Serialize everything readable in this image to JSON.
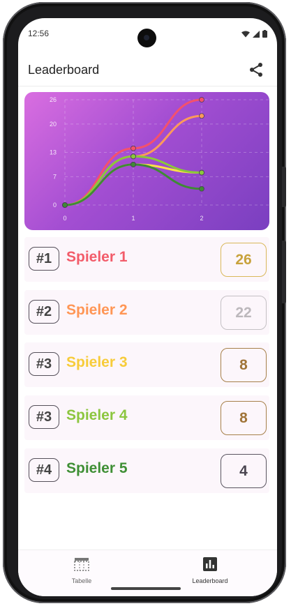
{
  "status": {
    "time": "12:56"
  },
  "appbar": {
    "title": "Leaderboard",
    "share_icon": "share-icon"
  },
  "chart_data": {
    "type": "line",
    "x": [
      0,
      1,
      2
    ],
    "x_ticks": [
      "0",
      "1",
      "2"
    ],
    "y_ticks": [
      "0",
      "7",
      "13",
      "20",
      "26"
    ],
    "ylim": [
      0,
      26
    ],
    "grid": true,
    "series": [
      {
        "color": "#f4516c",
        "values": [
          0,
          14,
          26
        ]
      },
      {
        "color": "#ff9a5a",
        "values": [
          0,
          12,
          22
        ]
      },
      {
        "color": "#fde047",
        "values": [
          0,
          10,
          8
        ]
      },
      {
        "color": "#8bc83a",
        "values": [
          0,
          12,
          8
        ]
      },
      {
        "color": "#3f8a35",
        "values": [
          0,
          10,
          4
        ]
      }
    ]
  },
  "leaderboard": [
    {
      "rank": "#1",
      "name": "Spieler 1",
      "score": "26",
      "color": "#f25c6a",
      "score_color": "#c8a23c",
      "border": "#d9b85a"
    },
    {
      "rank": "#2",
      "name": "Spieler 2",
      "score": "22",
      "color": "#ff9655",
      "score_color": "#bcb8bc",
      "border": "#c4c0c4"
    },
    {
      "rank": "#3",
      "name": "Spieler 3",
      "score": "8",
      "color": "#f7cc3a",
      "score_color": "#a07438",
      "border": "#a6804a"
    },
    {
      "rank": "#3",
      "name": "Spieler 4",
      "score": "8",
      "color": "#8cc63f",
      "score_color": "#a07438",
      "border": "#a6804a"
    },
    {
      "rank": "#4",
      "name": "Spieler 5",
      "score": "4",
      "color": "#3f8f35",
      "score_color": "#4a4550",
      "border": "#5a5560"
    }
  ],
  "nav": {
    "tab1_label": "Tabelle",
    "tab1_icon": "table-icon",
    "tab2_label": "Leaderboard",
    "tab2_icon": "bar-chart-icon"
  }
}
